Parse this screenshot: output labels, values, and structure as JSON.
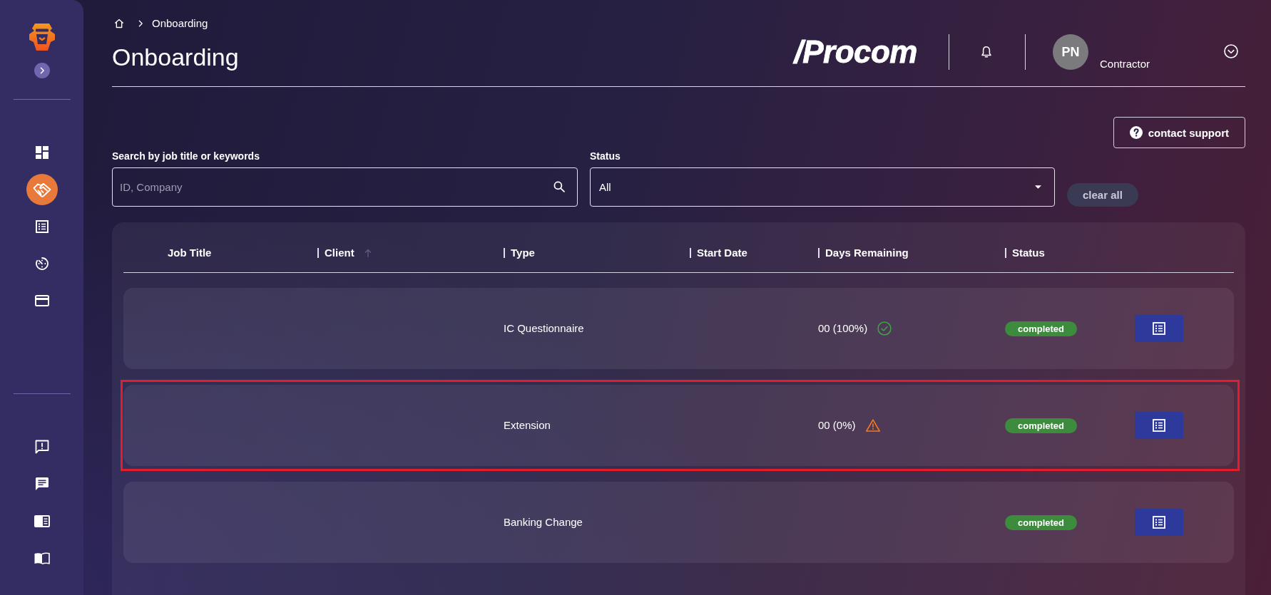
{
  "sidebar": {
    "nav_items": [
      {
        "kind": "dashboard",
        "selected": false
      },
      {
        "kind": "handshake",
        "selected": true
      },
      {
        "kind": "checklist",
        "selected": false
      },
      {
        "kind": "timer",
        "selected": false
      },
      {
        "kind": "card",
        "selected": false
      }
    ],
    "footer_items": [
      {
        "kind": "alert",
        "selected": false
      },
      {
        "kind": "chat",
        "selected": false
      },
      {
        "kind": "reader",
        "selected": false
      },
      {
        "kind": "book",
        "selected": false
      }
    ]
  },
  "header": {
    "breadcrumb": [
      "Onboarding"
    ],
    "title": "Onboarding",
    "brand": "/Procom",
    "user": {
      "initials": "PN",
      "role": "Contractor"
    }
  },
  "contact_support": "contact support",
  "filters": {
    "search": {
      "label": "Search by job title or keywords",
      "placeholder": "ID, Company"
    },
    "status": {
      "label": "Status",
      "value": "All"
    },
    "clear_button": "clear all"
  },
  "table": {
    "columns": [
      {
        "label": "Job Title",
        "sorted": false
      },
      {
        "label": "Client",
        "sorted": true
      },
      {
        "label": "Type",
        "sorted": false
      },
      {
        "label": "Start Date",
        "sorted": false
      },
      {
        "label": "Days Remaining",
        "sorted": false
      },
      {
        "label": "Status",
        "sorted": false
      }
    ],
    "rows": [
      {
        "type": "IC Questionnaire",
        "days_remaining": {
          "text": "00 (100%)",
          "kind": "check"
        },
        "status": "completed",
        "highlighted": false
      },
      {
        "type": "Extension",
        "days_remaining": {
          "text": "00 (0%)",
          "kind": "warning"
        },
        "status": "completed",
        "highlighted": true
      },
      {
        "type": "Banking Change",
        "status": "completed",
        "highlighted": false
      }
    ]
  }
}
